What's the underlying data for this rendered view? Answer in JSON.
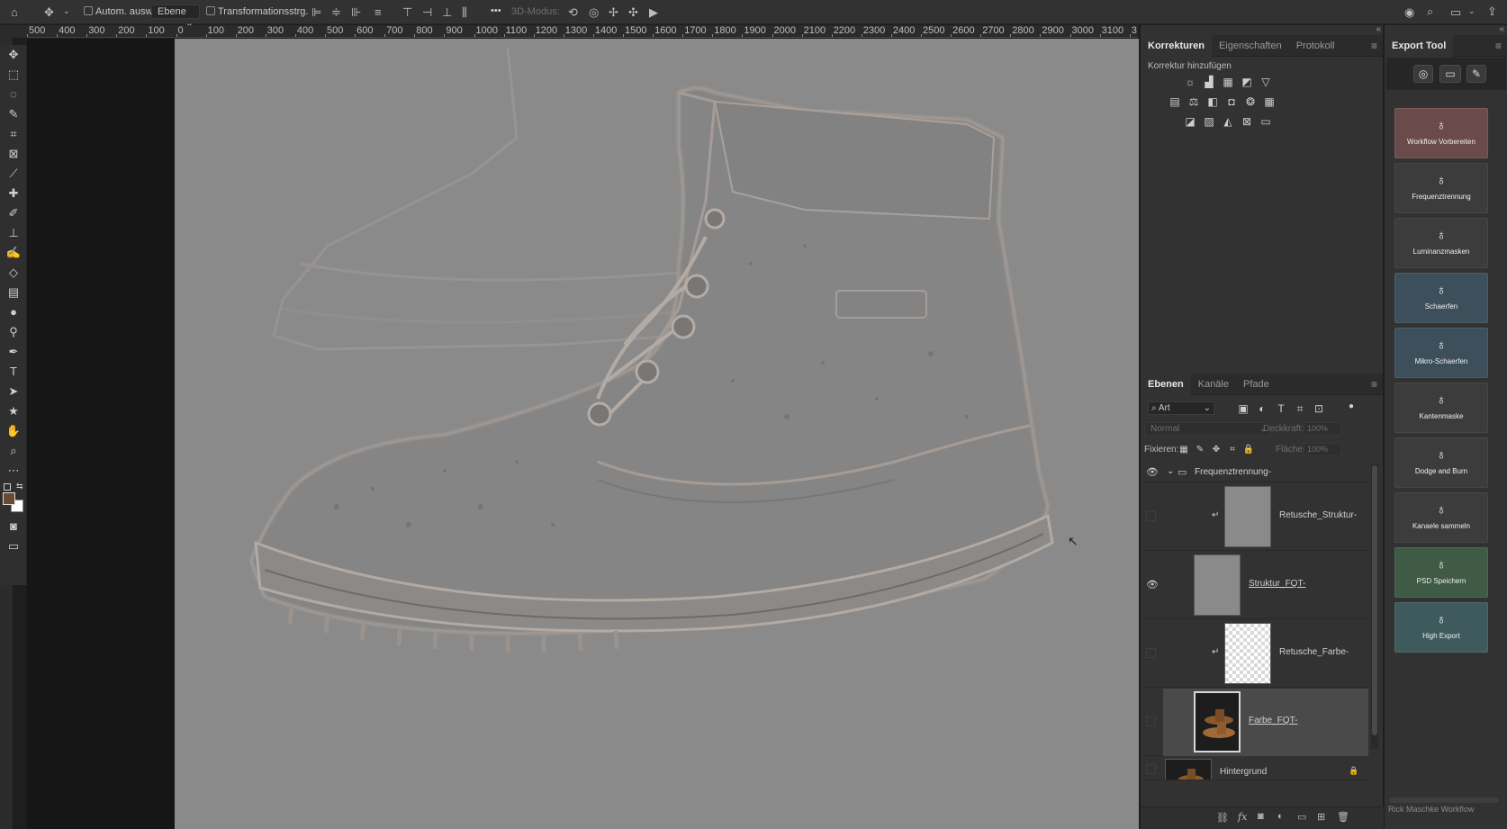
{
  "options_bar": {
    "auto_select_label": "Autom. ausw.:",
    "auto_select_value": "Ebene",
    "transform_label": "Transformationsstrg.",
    "more_label": "•••",
    "mode_3d_label": "3D-Modus:"
  },
  "ruler": {
    "h_ticks": [
      "500",
      "400",
      "300",
      "200",
      "100",
      "0",
      "100",
      "200",
      "300",
      "400",
      "500",
      "600",
      "700",
      "800",
      "900",
      "1000",
      "1100",
      "1200",
      "1300",
      "1400",
      "1500",
      "1600",
      "1700",
      "1800",
      "1900",
      "2000",
      "2100",
      "2200",
      "2300",
      "2400",
      "2500",
      "2600",
      "2700",
      "2800",
      "2900",
      "3000",
      "3100",
      "3"
    ]
  },
  "adjustments_panel": {
    "tabs": [
      "Korrekturen",
      "Eigenschaften",
      "Protokoll"
    ],
    "active_tab": "Korrekturen",
    "heading": "Korrektur hinzufügen"
  },
  "layers_panel": {
    "tabs": [
      "Ebenen",
      "Kanäle",
      "Pfade"
    ],
    "active_tab": "Ebenen",
    "filter_value": "Art",
    "blend_mode": "Normal",
    "opacity_label": "Deckkraft:",
    "opacity_value": "100%",
    "lock_label": "Fixieren:",
    "fill_label": "Fläche:",
    "fill_value": "100%",
    "layers": [
      {
        "name": "Frequenztrennung-",
        "type": "group",
        "visible": true
      },
      {
        "name": "Retusche_Struktur-",
        "type": "clipped",
        "visible": false
      },
      {
        "name": "Struktur_FQT-",
        "type": "layer",
        "visible": true
      },
      {
        "name": "Retusche_Farbe-",
        "type": "clipped",
        "visible": false
      },
      {
        "name": "Farbe_FQT-",
        "type": "layer",
        "visible": false,
        "selected": true
      },
      {
        "name": "Hintergrund",
        "type": "background",
        "visible": false,
        "locked": true
      }
    ],
    "footer_fx": "fx"
  },
  "export_tool": {
    "title": "Export Tool",
    "buttons": [
      {
        "label": "Workflow Vorbereiten",
        "color": "#6b4a4c"
      },
      {
        "label": "Frequenztrennung",
        "color": "#3c3c3c"
      },
      {
        "label": "Luminanzmasken",
        "color": "#3c3c3c"
      },
      {
        "label": "Schaerfen",
        "color": "#3d4f5b"
      },
      {
        "label": "Mikro-Schaerfen",
        "color": "#3d4f5b"
      },
      {
        "label": "Kantenmaske",
        "color": "#3c3c3c"
      },
      {
        "label": "Dodge and Burn",
        "color": "#3c3c3c"
      },
      {
        "label": "Kanaele sammeln",
        "color": "#3c3c3c"
      },
      {
        "label": "PSD Speichern",
        "color": "#3f5a45"
      },
      {
        "label": "High Export",
        "color": "#3f5a5c"
      }
    ],
    "footer": "Rick Maschke Workflow"
  },
  "colors": {
    "foreground": "#6b4a33",
    "background": "#ffffff",
    "canvas_gray": "#8a8a8a"
  }
}
